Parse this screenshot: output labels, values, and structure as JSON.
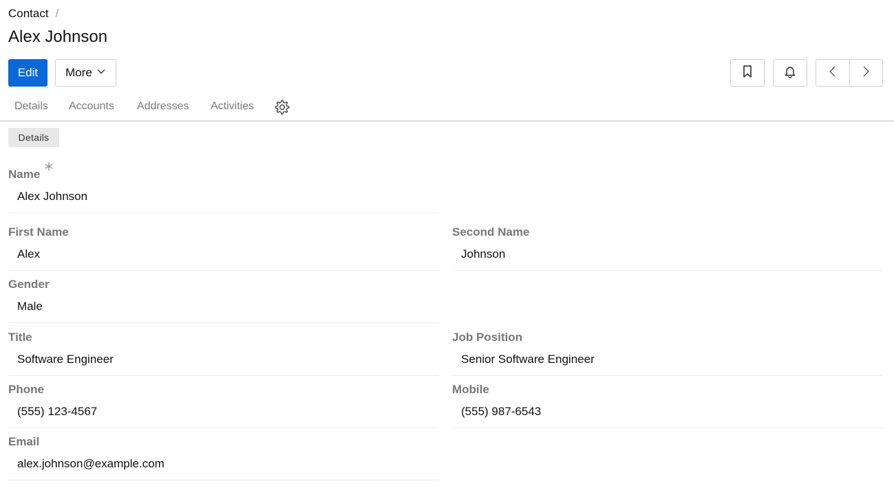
{
  "breadcrumb": {
    "root": "Contact",
    "separator": "/"
  },
  "title": "Alex Johnson",
  "toolbar": {
    "edit_label": "Edit",
    "more_label": "More"
  },
  "icons": {
    "bookmark": "bookmark-icon",
    "bell": "bell-icon",
    "prev": "chevron-left-icon",
    "next": "chevron-right-icon",
    "settings": "gear-icon",
    "required": "asterisk-icon"
  },
  "tabs": [
    {
      "label": "Details"
    },
    {
      "label": "Accounts"
    },
    {
      "label": "Addresses"
    },
    {
      "label": "Activities"
    }
  ],
  "panel": {
    "label": "Details"
  },
  "fields": {
    "name": {
      "label": "Name",
      "value": "Alex Johnson"
    },
    "first_name": {
      "label": "First Name",
      "value": "Alex"
    },
    "second_name": {
      "label": "Second Name",
      "value": "Johnson"
    },
    "gender": {
      "label": "Gender",
      "value": "Male"
    },
    "title": {
      "label": "Title",
      "value": "Software Engineer"
    },
    "job_position": {
      "label": "Job Position",
      "value": "Senior Software Engineer"
    },
    "phone": {
      "label": "Phone",
      "value": "(555) 123-4567"
    },
    "mobile": {
      "label": "Mobile",
      "value": "(555) 987-6543"
    },
    "email": {
      "label": "Email",
      "value": "alex.johnson@example.com"
    }
  },
  "colors": {
    "primary": "#0a69d6",
    "label": "#777777",
    "tab": "#7a7a7a",
    "border": "#cfcfcf"
  }
}
